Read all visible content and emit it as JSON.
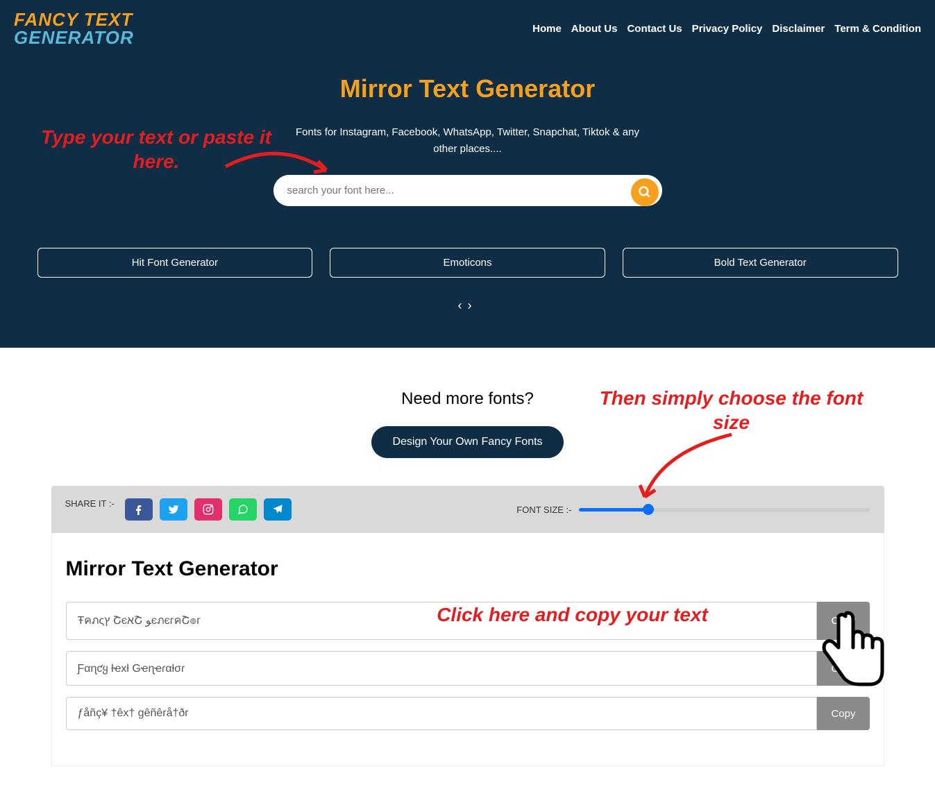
{
  "logo": {
    "line1": "FANCY TEXT",
    "line2": "GENERATOR"
  },
  "nav": {
    "home": "Home",
    "about": "About Us",
    "contact": "Contact Us",
    "privacy": "Privacy Policy",
    "disclaimer": "Disclaimer",
    "terms": "Term & Condition"
  },
  "hero": {
    "title": "Mirror Text Generator",
    "subtitle": "Fonts for Instagram, Facebook, WhatsApp, Twitter, Snapchat, Tiktok & any other places....",
    "search_placeholder": "search your font here..."
  },
  "pills": {
    "p1": "Hit Font Generator",
    "p2": "Emoticons",
    "p3": "Bold Text Generator"
  },
  "carousel": {
    "prev": "‹",
    "next": "›"
  },
  "annotations": {
    "a1": "Type your text or paste it here.",
    "a2": "Then simply choose the font size",
    "a3": "Click here and copy your text"
  },
  "body": {
    "need_more": "Need more fonts?",
    "design_btn": "Design Your Own Fancy Fonts"
  },
  "share": {
    "label": "SHARE IT :-",
    "font_size_label": "FONT SIZE :-",
    "slider_value": 23
  },
  "results": {
    "title": "Mirror Text Generator",
    "rows": [
      {
        "text": "Ŧคภςץ ՇєאՇ ﻮєภєгคՇ๏г",
        "copy": "Copy"
      },
      {
        "text": "Ƒαɳƈყ ƚҽxƚ Gҽɳҽɾαƚσɾ",
        "copy": "Copy"
      },
      {
        "text": "ƒåñç¥ †êx† gêñêrå†ðr",
        "copy": "Copy"
      }
    ]
  }
}
